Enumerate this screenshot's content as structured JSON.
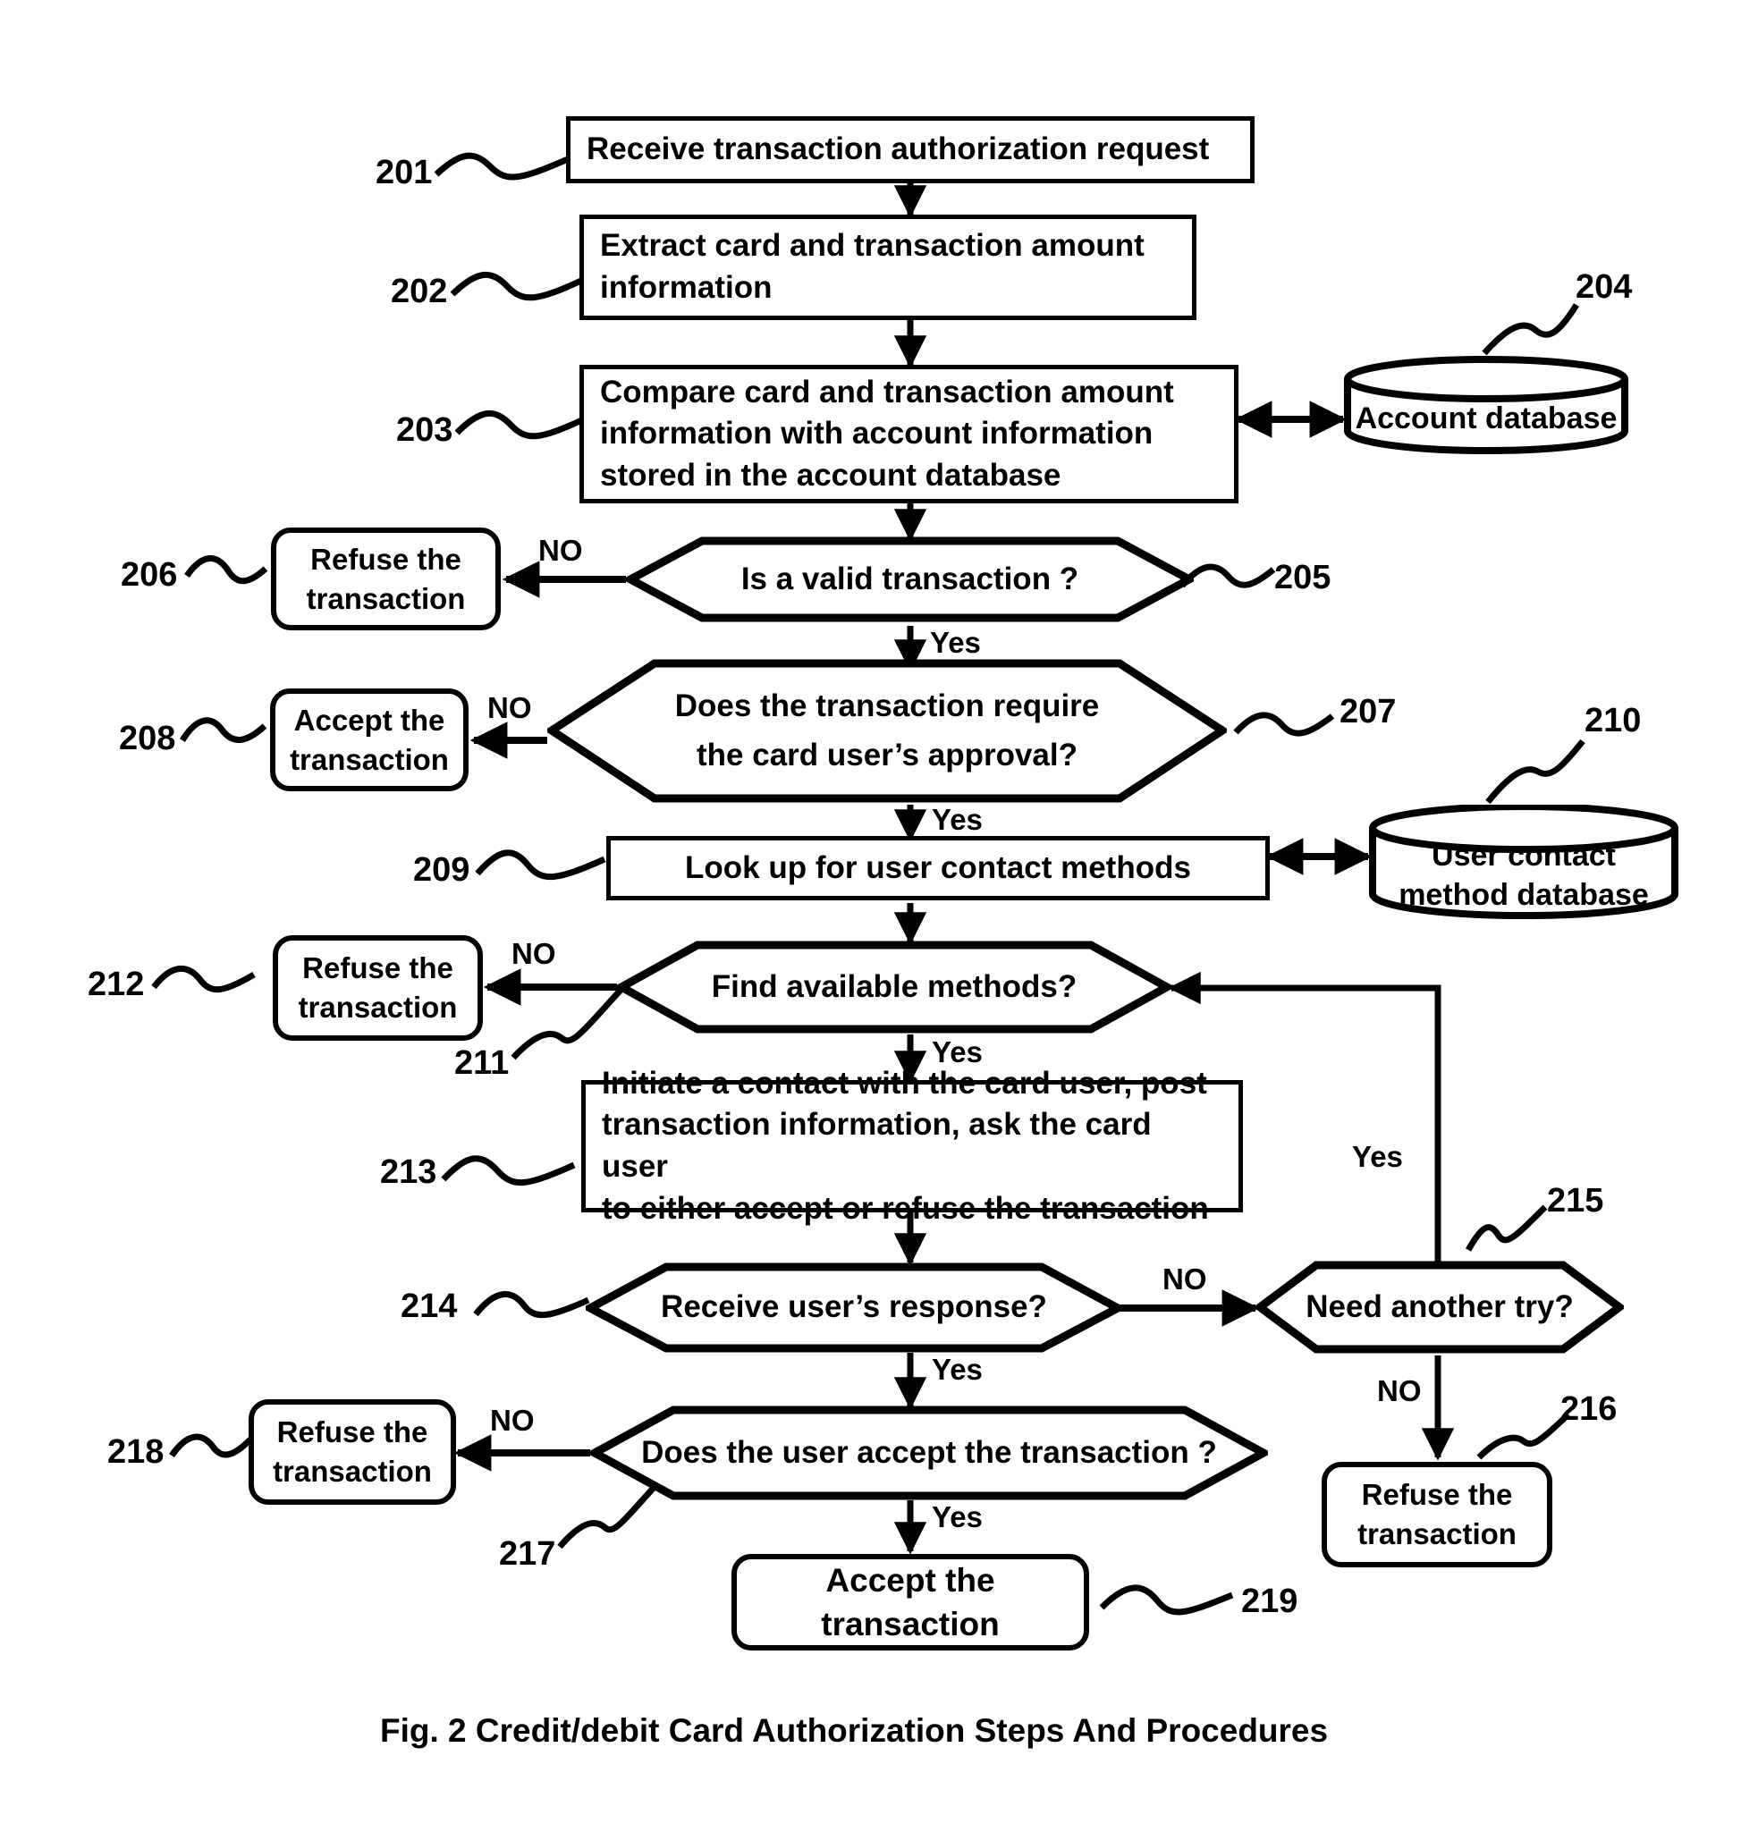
{
  "figure": {
    "caption": "Fig. 2  Credit/debit Card Authorization Steps And Procedures"
  },
  "chart_data": {
    "type": "flowchart",
    "title": "Fig. 2  Credit/debit Card Authorization Steps And Procedures",
    "nodes": [
      {
        "ref": "201",
        "shape": "process",
        "text": "Receive transaction authorization request"
      },
      {
        "ref": "202",
        "shape": "process",
        "text": "Extract card and transaction amount information"
      },
      {
        "ref": "203",
        "shape": "process",
        "text": "Compare card and transaction amount information with account information stored in the account database"
      },
      {
        "ref": "204",
        "shape": "database",
        "text": "Account database"
      },
      {
        "ref": "205",
        "shape": "decision",
        "text": "Is a valid transaction ?"
      },
      {
        "ref": "206",
        "shape": "terminal",
        "text": "Refuse the transaction"
      },
      {
        "ref": "207",
        "shape": "decision",
        "text": "Does the transaction require the card user's approval?"
      },
      {
        "ref": "208",
        "shape": "terminal",
        "text": "Accept the transaction"
      },
      {
        "ref": "209",
        "shape": "process",
        "text": "Look up for user contact methods"
      },
      {
        "ref": "210",
        "shape": "database",
        "text": "User contact method database"
      },
      {
        "ref": "211",
        "shape": "decision",
        "text": "Find available methods?"
      },
      {
        "ref": "212",
        "shape": "terminal",
        "text": "Refuse the transaction"
      },
      {
        "ref": "213",
        "shape": "process",
        "text": "Initiate a contact with the card user, post transaction information, ask the card user to either accept or refuse the transaction"
      },
      {
        "ref": "214",
        "shape": "decision",
        "text": "Receive user's response?"
      },
      {
        "ref": "215",
        "shape": "decision",
        "text": "Need another try?"
      },
      {
        "ref": "216",
        "shape": "terminal",
        "text": "Refuse the transaction"
      },
      {
        "ref": "217",
        "shape": "decision",
        "text": "Does the user accept the transaction ?"
      },
      {
        "ref": "218",
        "shape": "terminal",
        "text": "Refuse the transaction"
      },
      {
        "ref": "219",
        "shape": "terminal",
        "text": "Accept the transaction"
      }
    ],
    "edges": [
      {
        "from": "201",
        "to": "202",
        "label": ""
      },
      {
        "from": "202",
        "to": "203",
        "label": ""
      },
      {
        "from": "203",
        "to": "204",
        "label": "",
        "bidirectional": true
      },
      {
        "from": "203",
        "to": "205",
        "label": ""
      },
      {
        "from": "205",
        "to": "206",
        "label": "NO"
      },
      {
        "from": "205",
        "to": "207",
        "label": "Yes"
      },
      {
        "from": "207",
        "to": "208",
        "label": "NO"
      },
      {
        "from": "207",
        "to": "209",
        "label": "Yes"
      },
      {
        "from": "209",
        "to": "210",
        "label": "",
        "bidirectional": true
      },
      {
        "from": "209",
        "to": "211",
        "label": ""
      },
      {
        "from": "211",
        "to": "212",
        "label": "NO"
      },
      {
        "from": "211",
        "to": "213",
        "label": "Yes"
      },
      {
        "from": "213",
        "to": "214",
        "label": ""
      },
      {
        "from": "214",
        "to": "215",
        "label": "NO"
      },
      {
        "from": "214",
        "to": "217",
        "label": "Yes"
      },
      {
        "from": "215",
        "to": "211",
        "label": "Yes"
      },
      {
        "from": "215",
        "to": "216",
        "label": "NO"
      },
      {
        "from": "217",
        "to": "218",
        "label": "NO"
      },
      {
        "from": "217",
        "to": "219",
        "label": "Yes"
      }
    ]
  },
  "nodes": {
    "n201": {
      "ref": "201",
      "text": "Receive transaction authorization request"
    },
    "n202": {
      "ref": "202",
      "line1": "Extract card and transaction amount",
      "line2": "information"
    },
    "n203": {
      "ref": "203",
      "line1": "Compare card and transaction amount",
      "line2": "information with account information",
      "line3": "stored in the account database"
    },
    "n204": {
      "ref": "204",
      "text": "Account database"
    },
    "n205": {
      "ref": "205",
      "text": "Is a valid transaction ?"
    },
    "n206": {
      "ref": "206",
      "line1": "Refuse the",
      "line2": "transaction"
    },
    "n207": {
      "ref": "207",
      "line1": "Does the transaction require",
      "line2": "the card user’s approval?"
    },
    "n208": {
      "ref": "208",
      "line1": "Accept the",
      "line2": "transaction"
    },
    "n209": {
      "ref": "209",
      "text": "Look up for user contact methods"
    },
    "n210": {
      "ref": "210",
      "line1": "User contact",
      "line2": "method database"
    },
    "n211": {
      "ref": "211",
      "text": "Find available methods?"
    },
    "n212": {
      "ref": "212",
      "line1": "Refuse the",
      "line2": "transaction"
    },
    "n213": {
      "ref": "213",
      "line1": "Initiate a contact with the card user, post",
      "line2": "transaction information, ask the card user",
      "line3": "to either accept or refuse the transaction"
    },
    "n214": {
      "ref": "214",
      "text": "Receive user’s response?"
    },
    "n215": {
      "ref": "215",
      "text": "Need another try?"
    },
    "n216": {
      "ref": "216",
      "line1": "Refuse the",
      "line2": "transaction"
    },
    "n217": {
      "ref": "217",
      "text": "Does the user accept the transaction ?"
    },
    "n218": {
      "ref": "218",
      "line1": "Refuse the",
      "line2": "transaction"
    },
    "n219": {
      "ref": "219",
      "text": "Accept the transaction"
    }
  },
  "edge_labels": {
    "e205_no": "NO",
    "e205_yes": "Yes",
    "e207_no": "NO",
    "e207_yes": "Yes",
    "e211_no": "NO",
    "e211_yes": "Yes",
    "e214_no": "NO",
    "e214_yes": "Yes",
    "e215_yes": "Yes",
    "e215_no": "NO",
    "e217_no": "NO",
    "e217_yes": "Yes"
  },
  "colors": {
    "stroke": "#000000",
    "background": "#ffffff"
  }
}
